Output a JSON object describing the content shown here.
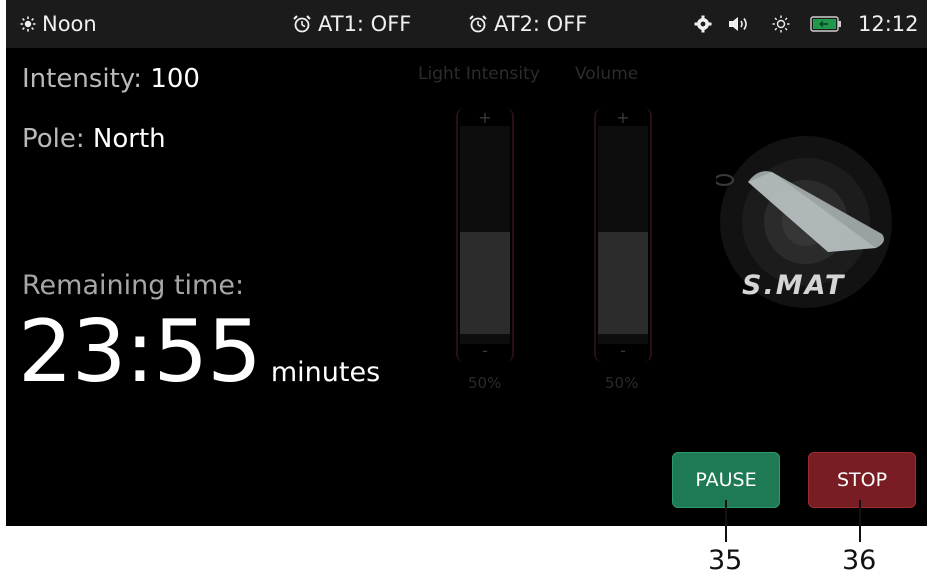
{
  "status_bar": {
    "mode": "Noon",
    "alarm1": "AT1: OFF",
    "alarm2": "AT2: OFF",
    "time": "12:12",
    "icons": [
      "sun-icon",
      "alarm-clock-icon",
      "alarm-clock-icon",
      "gear-icon",
      "speaker-icon",
      "brightness-icon",
      "battery-icon"
    ],
    "battery_color": "#1f9a4c"
  },
  "info": {
    "intensity_label": "Intensity:",
    "intensity_value": "100",
    "pole_label": "Pole:",
    "pole_value": "North"
  },
  "timer": {
    "label": "Remaining time:",
    "value": "23:55",
    "unit": "minutes"
  },
  "sliders": {
    "light": {
      "title": "Light Intensity",
      "plus": "+",
      "minus": "-",
      "value_text": "50%",
      "level": 0.5
    },
    "volume": {
      "title": "Volume",
      "plus": "+",
      "minus": "-",
      "value_text": "50%",
      "level": 0.5
    }
  },
  "logo": {
    "text": "S.MAT"
  },
  "buttons": {
    "pause_label": "PAUSE",
    "stop_label": "STOP",
    "pause_color": "#1d7a55",
    "stop_color": "#7a1c24"
  },
  "callouts": {
    "pause_number": "35",
    "stop_number": "36"
  }
}
